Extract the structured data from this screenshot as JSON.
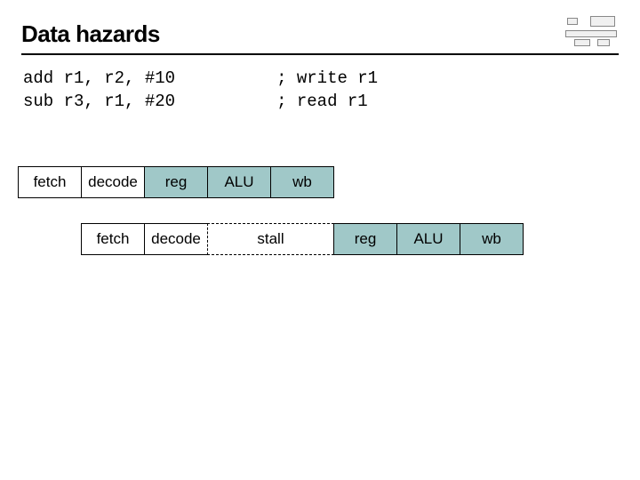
{
  "title": "Data hazards",
  "code": {
    "line1_instr": "add r1, r2, #10",
    "line1_comment": "; write r1",
    "line2_instr": "sub r3, r1, #20",
    "line2_comment": "; read r1"
  },
  "stages": {
    "fetch": "fetch",
    "decode": "decode",
    "reg": "reg",
    "alu": "ALU",
    "wb": "wb",
    "stall": "stall"
  }
}
